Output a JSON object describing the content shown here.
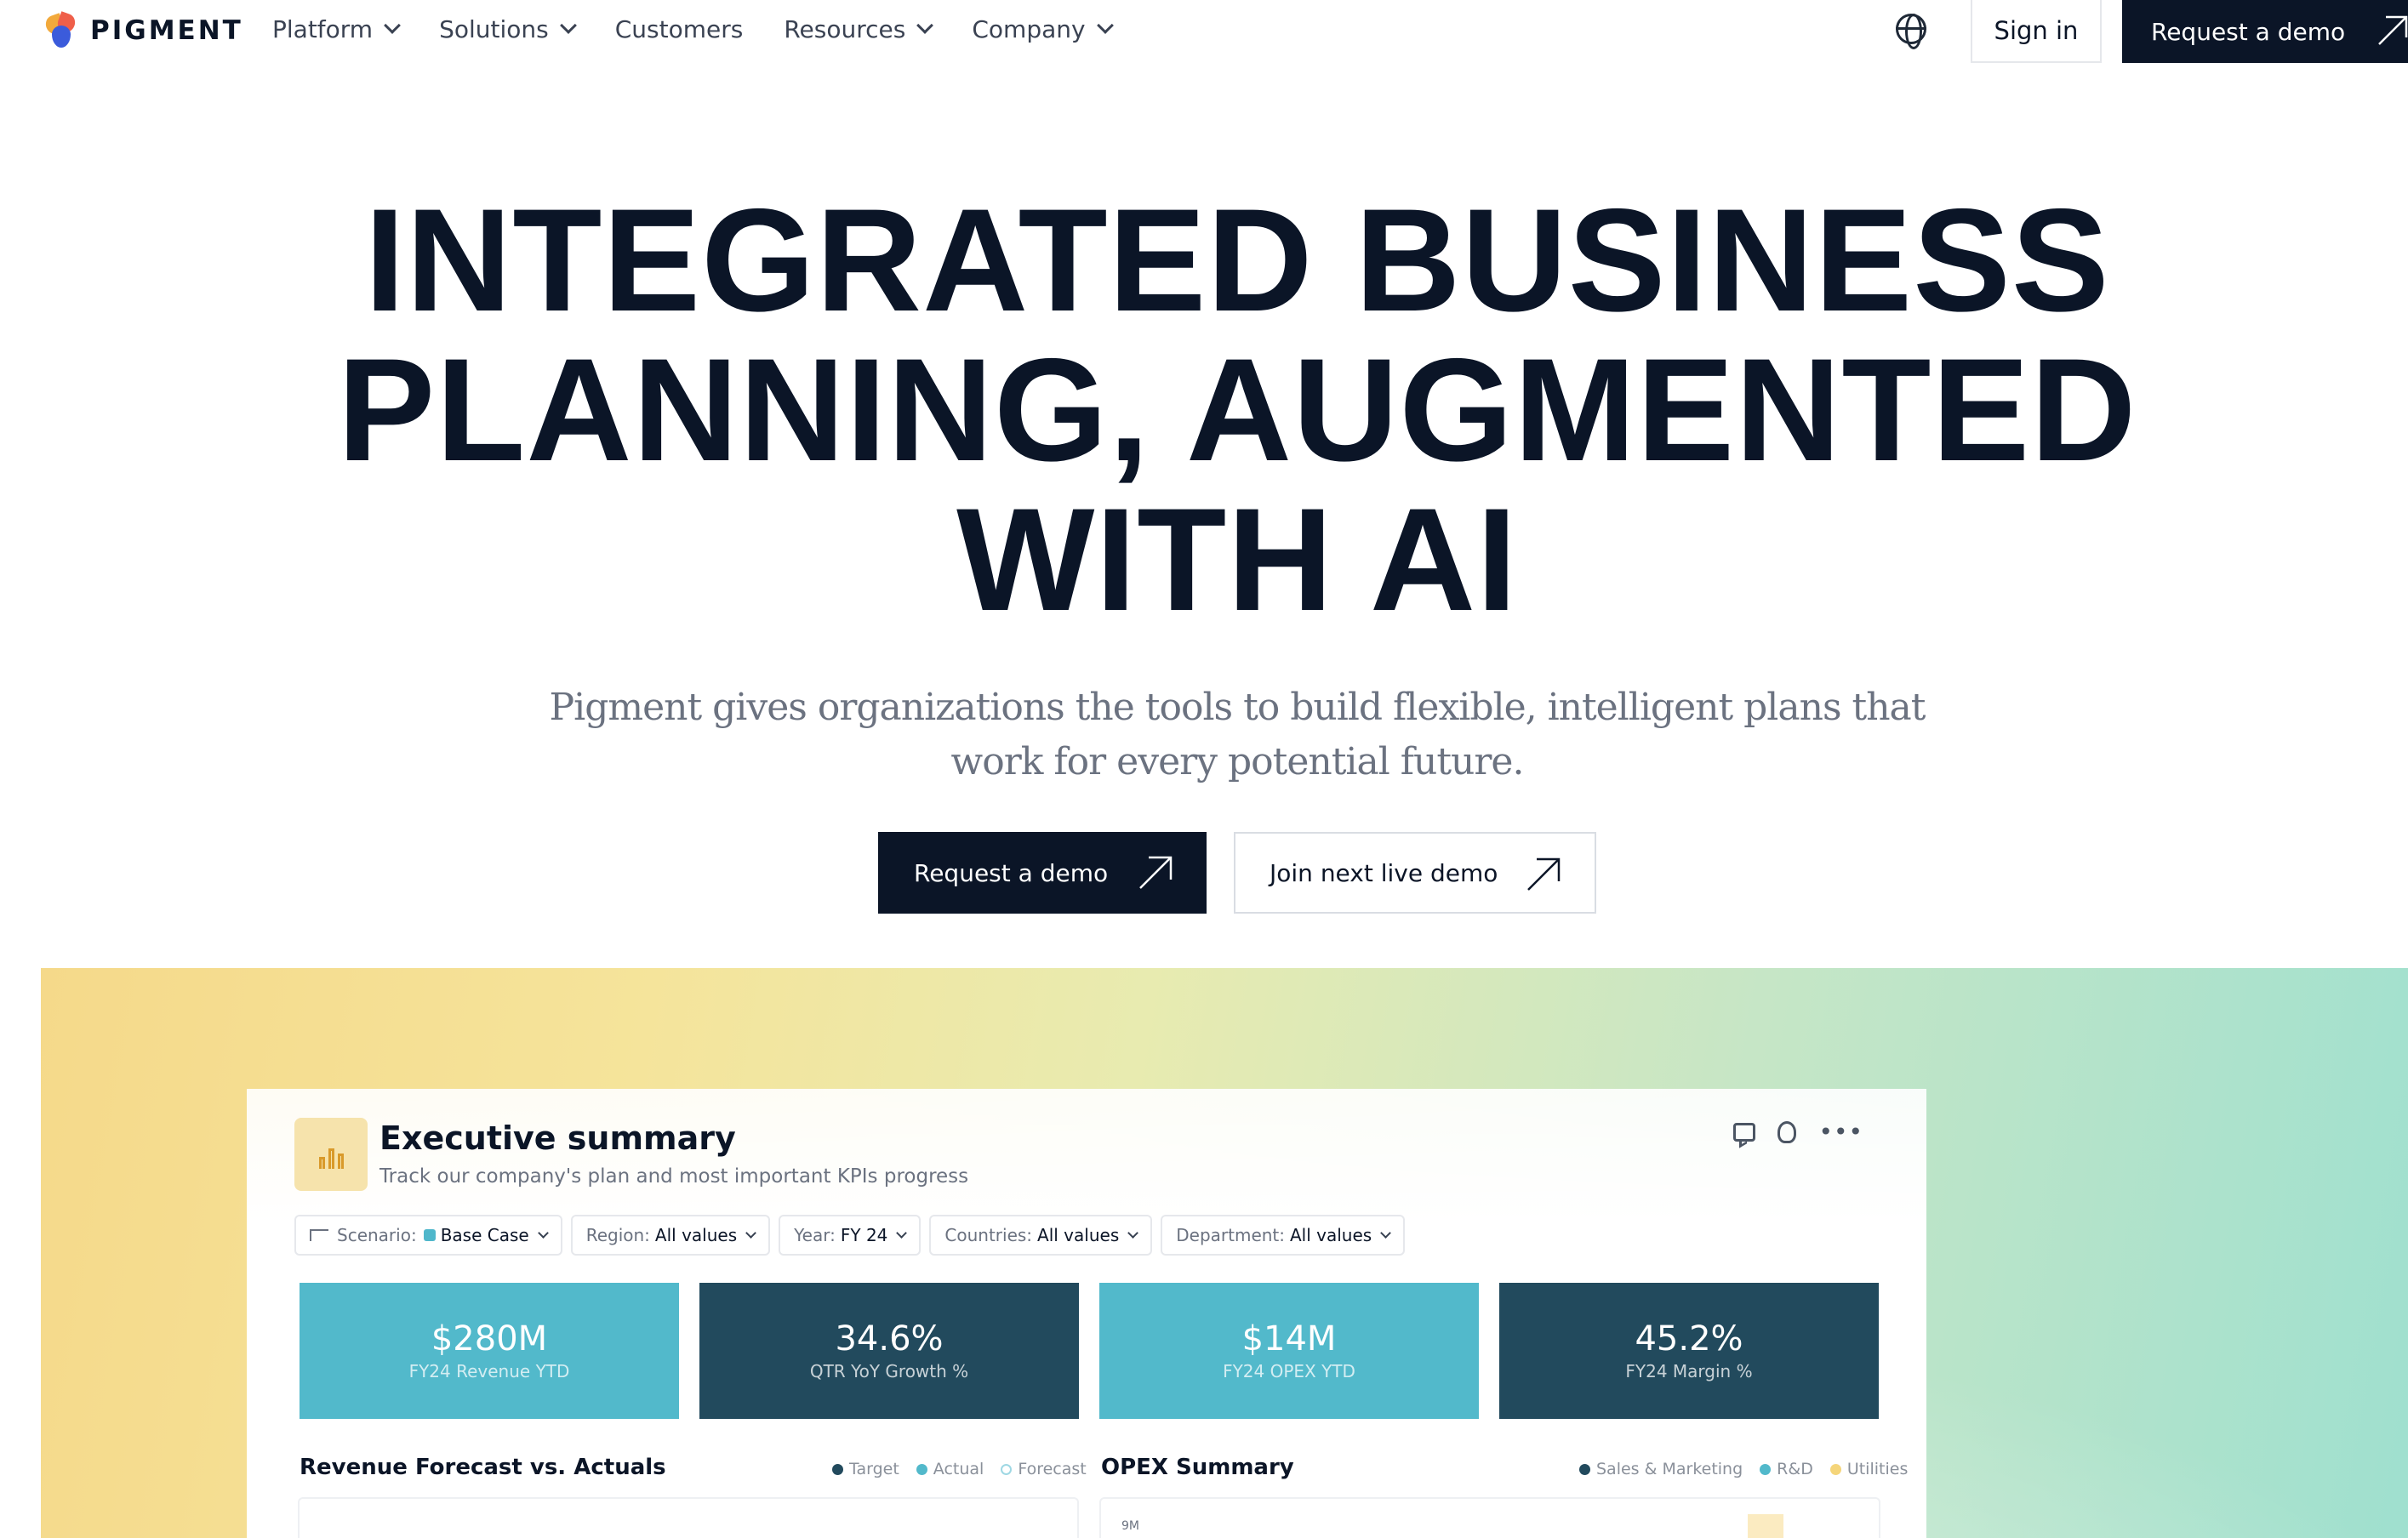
{
  "brand": {
    "name": "PIGMENT"
  },
  "nav": {
    "items": [
      {
        "label": "Platform",
        "dropdown": true
      },
      {
        "label": "Solutions",
        "dropdown": true
      },
      {
        "label": "Customers",
        "dropdown": false
      },
      {
        "label": "Resources",
        "dropdown": true
      },
      {
        "label": "Company",
        "dropdown": true
      }
    ],
    "sign_in": "Sign in",
    "request_demo": "Request a demo"
  },
  "hero": {
    "title_lines": [
      "INTEGRATED BUSINESS",
      "PLANNING, AUGMENTED",
      "WITH AI"
    ],
    "subtitle": "Pigment gives organizations the tools to build flexible, intelligent plans that work for every potential future.",
    "primary_cta": "Request a demo",
    "secondary_cta": "Join next live demo"
  },
  "dashboard": {
    "title": "Executive summary",
    "description": "Track our company's plan and most important KPIs progress",
    "filters": [
      {
        "key": "Scenario:",
        "value": "Base Case"
      },
      {
        "key": "Region:",
        "value": "All values"
      },
      {
        "key": "Year:",
        "value": "FY 24"
      },
      {
        "key": "Countries:",
        "value": "All values"
      },
      {
        "key": "Department:",
        "value": "All values"
      }
    ],
    "kpis": [
      {
        "value": "$280M",
        "label": "FY24 Revenue YTD"
      },
      {
        "value": "34.6%",
        "label": "QTR YoY Growth %"
      },
      {
        "value": "$14M",
        "label": "FY24 OPEX YTD"
      },
      {
        "value": "45.2%",
        "label": "FY24 Margin %"
      }
    ],
    "revenue_chart": {
      "title": "Revenue Forecast vs. Actuals",
      "legend": [
        "Target",
        "Actual",
        "Forecast"
      ]
    },
    "opex_chart": {
      "title": "OPEX Summary",
      "legend": [
        "Sales & Marketing",
        "R&D",
        "Utilities"
      ],
      "y_tick_top": "9M"
    }
  },
  "colors": {
    "navy": "#0b1527",
    "kpi_light": "#52b9cb",
    "kpi_dark": "#224a5d",
    "legend_target": "#224a5d",
    "legend_actual": "#52b9cb",
    "legend_forecast": "#9fd8e4",
    "legend_sales": "#224a5d",
    "legend_rd": "#52b9cb",
    "legend_utilities": "#f5d57a"
  },
  "icons": {
    "globe": "globe-icon",
    "arrow": "arrow-up-right-icon",
    "comment": "comment-icon",
    "bulb": "lightbulb-icon",
    "more": "more-horizontal-icon",
    "chart": "bar-chart-icon",
    "scenario": "branch-icon"
  }
}
